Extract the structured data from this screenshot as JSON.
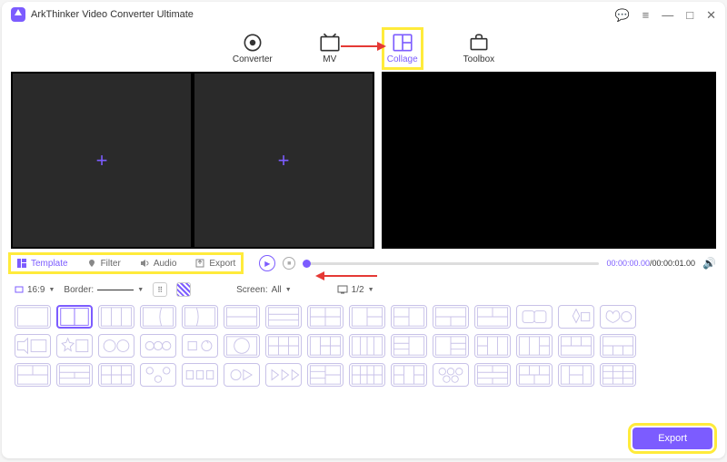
{
  "app": {
    "title": "ArkThinker Video Converter Ultimate"
  },
  "nav": {
    "converter": "Converter",
    "mv": "MV",
    "collage": "Collage",
    "toolbox": "Toolbox"
  },
  "tools": {
    "template": "Template",
    "filter": "Filter",
    "audio": "Audio",
    "export": "Export"
  },
  "playback": {
    "current": "00:00:00.00",
    "total": "00:00:01.00"
  },
  "options": {
    "aspect": "16:9",
    "border_label": "Border:",
    "screen_label": "Screen:",
    "screen_value": "All",
    "page": "1/2"
  },
  "footer": {
    "export": "Export"
  },
  "colors": {
    "accent": "#7c5cff",
    "highlight": "#ffeb3b"
  }
}
